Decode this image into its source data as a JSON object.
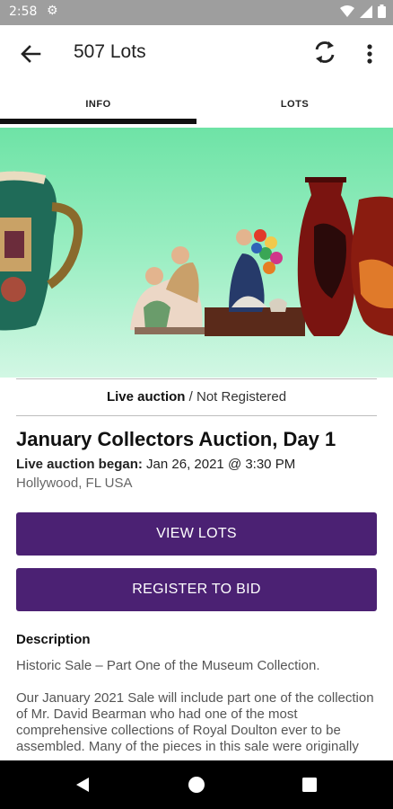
{
  "status_bar": {
    "time": "2:58"
  },
  "app_bar": {
    "title": "507 Lots"
  },
  "tabs": [
    {
      "label": "INFO"
    },
    {
      "label": "LOTS"
    }
  ],
  "auction": {
    "type": "Live auction",
    "registration": "/ Not Registered",
    "title": "January Collectors Auction, Day 1",
    "began_label": "Live auction began:",
    "began_value": "Jan 26, 2021 @ 3:30 PM",
    "location": "Hollywood, FL USA"
  },
  "buttons": {
    "view_lots": "VIEW LOTS",
    "register": "REGISTER TO BID"
  },
  "description": {
    "heading": "Description",
    "subtitle": "Historic Sale – Part One of the Museum Collection.",
    "body": "Our January 2021 Sale will include part one of the collection of Mr. David Bearman who had one of the most comprehensive collections of Royal Doulton ever to be assembled. Many of the pieces in this sale were originally"
  },
  "colors": {
    "accent": "#4b2173",
    "hero_bg": "#6ee3a6"
  }
}
